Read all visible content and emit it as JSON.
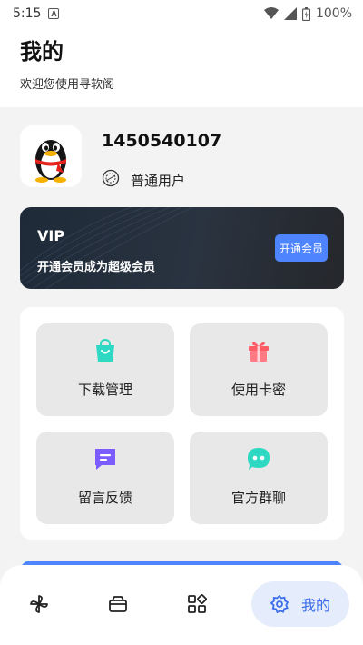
{
  "status_bar": {
    "time": "5:15",
    "notification_icon": "A",
    "battery": "100%"
  },
  "header": {
    "title": "我的",
    "subtitle": "欢迎您使用寻软阁"
  },
  "profile": {
    "user_id": "1450540107",
    "user_type": "普通用户",
    "avatar_icon": "qq-penguin-icon"
  },
  "vip": {
    "title": "VIP",
    "description": "开通会员成为超级会员",
    "button_label": "开通会员"
  },
  "menu": [
    {
      "label": "下载管理",
      "icon": "shopping-bag-icon",
      "color": "#2ed8c3"
    },
    {
      "label": "使用卡密",
      "icon": "gift-icon",
      "color": "#ff5c66"
    },
    {
      "label": "留言反馈",
      "icon": "message-icon",
      "color": "#7b5cff"
    },
    {
      "label": "官方群聊",
      "icon": "chat-group-icon",
      "color": "#2ed8c3"
    }
  ],
  "bottom_nav": {
    "items": [
      {
        "icon": "pinwheel-icon"
      },
      {
        "icon": "box-icon"
      },
      {
        "icon": "apps-icon"
      },
      {
        "icon": "settings-gear-icon",
        "label": "我的",
        "active": true
      }
    ],
    "accent": "#3b6ee8"
  }
}
